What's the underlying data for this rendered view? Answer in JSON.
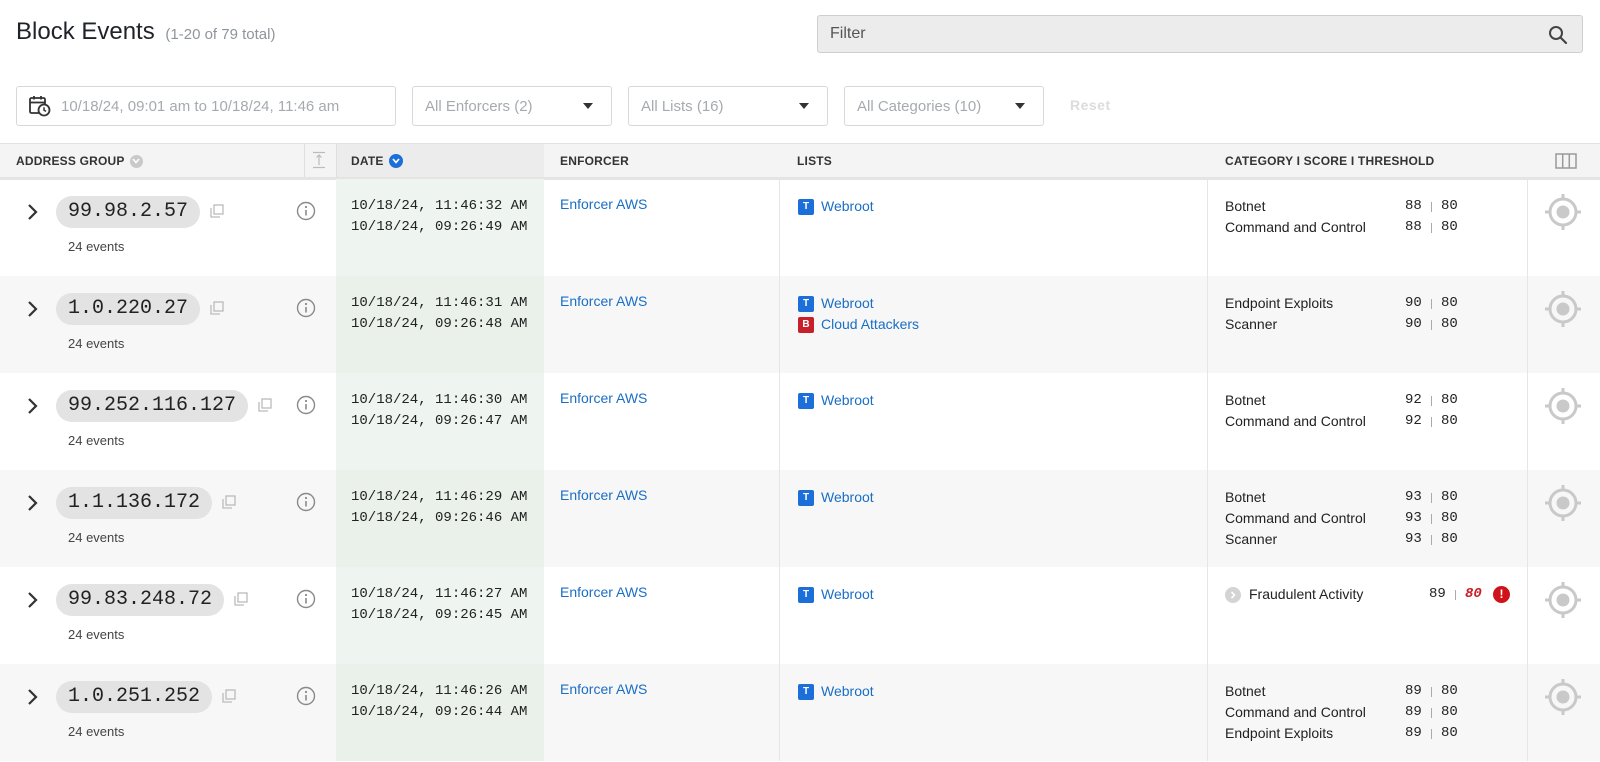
{
  "header": {
    "title": "Block Events",
    "subtitle": "(1-20 of 79 total)",
    "filter_placeholder": "Filter"
  },
  "controls": {
    "date_range": "10/18/24, 09:01 am to 10/18/24, 11:46 am",
    "enforcers": "All Enforcers (2)",
    "lists": "All Lists (16)",
    "categories": "All Categories (10)",
    "reset": "Reset"
  },
  "columns": {
    "address_group": "ADDRESS GROUP",
    "date": "DATE",
    "enforcer": "ENFORCER",
    "lists": "LISTS",
    "category": "CATEGORY I SCORE I THRESHOLD"
  },
  "colors": {
    "link": "#1a6ec5",
    "badge_T": "#1c6fd8",
    "badge_B": "#c8202a",
    "alert": "#d0121b"
  },
  "rows": [
    {
      "ip": "99.98.2.57",
      "events": "24 events",
      "date1": "10/18/24, 11:46:32 AM",
      "date2": "10/18/24, 09:26:49 AM",
      "enforcer": "Enforcer AWS",
      "lists": [
        {
          "badge": "T",
          "name": "Webroot"
        }
      ],
      "cats": [
        {
          "name": "Botnet",
          "score": "88",
          "thr": "80"
        },
        {
          "name": "Command and Control",
          "score": "88",
          "thr": "80"
        }
      ]
    },
    {
      "ip": "1.0.220.27",
      "events": "24 events",
      "date1": "10/18/24, 11:46:31 AM",
      "date2": "10/18/24, 09:26:48 AM",
      "enforcer": "Enforcer AWS",
      "lists": [
        {
          "badge": "T",
          "name": "Webroot"
        },
        {
          "badge": "B",
          "name": "Cloud Attackers"
        }
      ],
      "cats": [
        {
          "name": "Endpoint Exploits",
          "score": "90",
          "thr": "80"
        },
        {
          "name": "Scanner",
          "score": "90",
          "thr": "80"
        }
      ]
    },
    {
      "ip": "99.252.116.127",
      "events": "24 events",
      "date1": "10/18/24, 11:46:30 AM",
      "date2": "10/18/24, 09:26:47 AM",
      "enforcer": "Enforcer AWS",
      "lists": [
        {
          "badge": "T",
          "name": "Webroot"
        }
      ],
      "cats": [
        {
          "name": "Botnet",
          "score": "92",
          "thr": "80"
        },
        {
          "name": "Command and Control",
          "score": "92",
          "thr": "80"
        }
      ]
    },
    {
      "ip": "1.1.136.172",
      "events": "24 events",
      "date1": "10/18/24, 11:46:29 AM",
      "date2": "10/18/24, 09:26:46 AM",
      "enforcer": "Enforcer AWS",
      "lists": [
        {
          "badge": "T",
          "name": "Webroot"
        }
      ],
      "cats": [
        {
          "name": "Botnet",
          "score": "93",
          "thr": "80"
        },
        {
          "name": "Command and Control",
          "score": "93",
          "thr": "80"
        },
        {
          "name": "Scanner",
          "score": "93",
          "thr": "80"
        }
      ]
    },
    {
      "ip": "99.83.248.72",
      "events": "24 events",
      "date1": "10/18/24, 11:46:27 AM",
      "date2": "10/18/24, 09:26:45 AM",
      "enforcer": "Enforcer AWS",
      "lists": [
        {
          "badge": "T",
          "name": "Webroot"
        }
      ],
      "cats": [
        {
          "name": "Fraudulent Activity",
          "score": "89",
          "thr": "80",
          "warn": true
        }
      ]
    },
    {
      "ip": "1.0.251.252",
      "events": "24 events",
      "date1": "10/18/24, 11:46:26 AM",
      "date2": "10/18/24, 09:26:44 AM",
      "enforcer": "Enforcer AWS",
      "lists": [
        {
          "badge": "T",
          "name": "Webroot"
        }
      ],
      "cats": [
        {
          "name": "Botnet",
          "score": "89",
          "thr": "80"
        },
        {
          "name": "Command and Control",
          "score": "89",
          "thr": "80"
        },
        {
          "name": "Endpoint Exploits",
          "score": "89",
          "thr": "80"
        }
      ]
    }
  ]
}
